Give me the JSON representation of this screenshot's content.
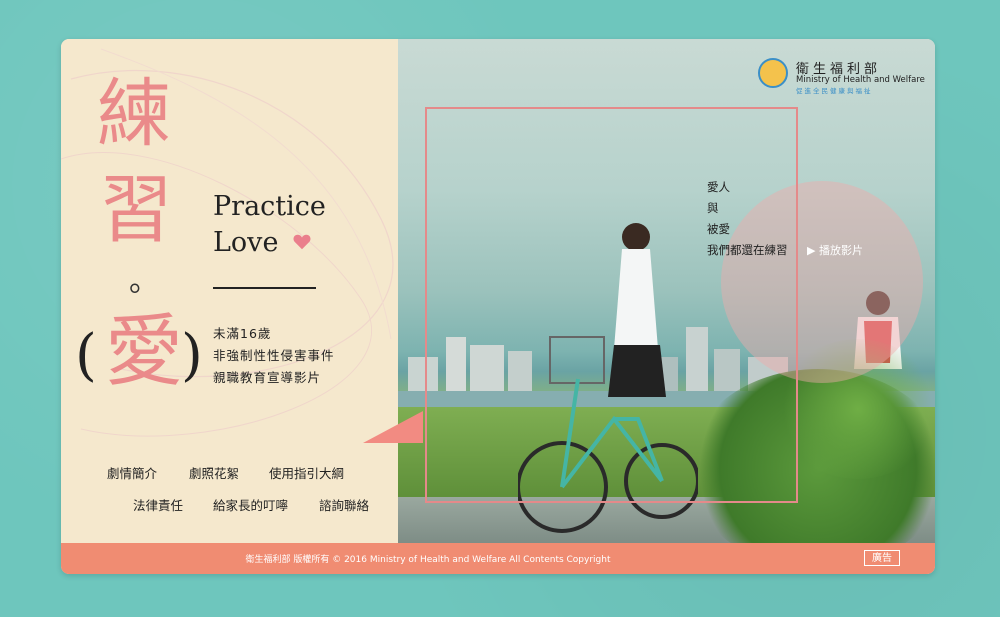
{
  "title": {
    "chars": [
      "練",
      "習",
      "。",
      "愛"
    ],
    "paren_left": "(",
    "paren_right": ")",
    "en_line1": "Practice",
    "en_line2": "Love"
  },
  "subtitle": {
    "line1": "未滿16歲",
    "line2": "非強制性性侵害事件",
    "line3": "親職教育宣導影片"
  },
  "nav": {
    "items": [
      "劇情簡介",
      "劇照花絮",
      "使用指引大綱",
      "法律責任",
      "給家長的叮嚀",
      "諮詢聯絡"
    ]
  },
  "poem": {
    "line1": "愛人",
    "line2": "與",
    "line3": "被愛",
    "line4": "我們都還在練習"
  },
  "play_button": "▶ 播放影片",
  "logo": {
    "title": "衛生福利部",
    "english": "Ministry of Health and Welfare",
    "slogan": "促進全民健康與福祉"
  },
  "footer": {
    "copyright": "衛生福利部 版權所有 © 2016 Ministry of Health and Welfare All Contents Copyright",
    "ad_label": "廣告"
  },
  "colors": {
    "background": "#6ec6bd",
    "cream": "#f5e8cd",
    "pink": "#ea8a8a",
    "footer": "#f08c72"
  }
}
